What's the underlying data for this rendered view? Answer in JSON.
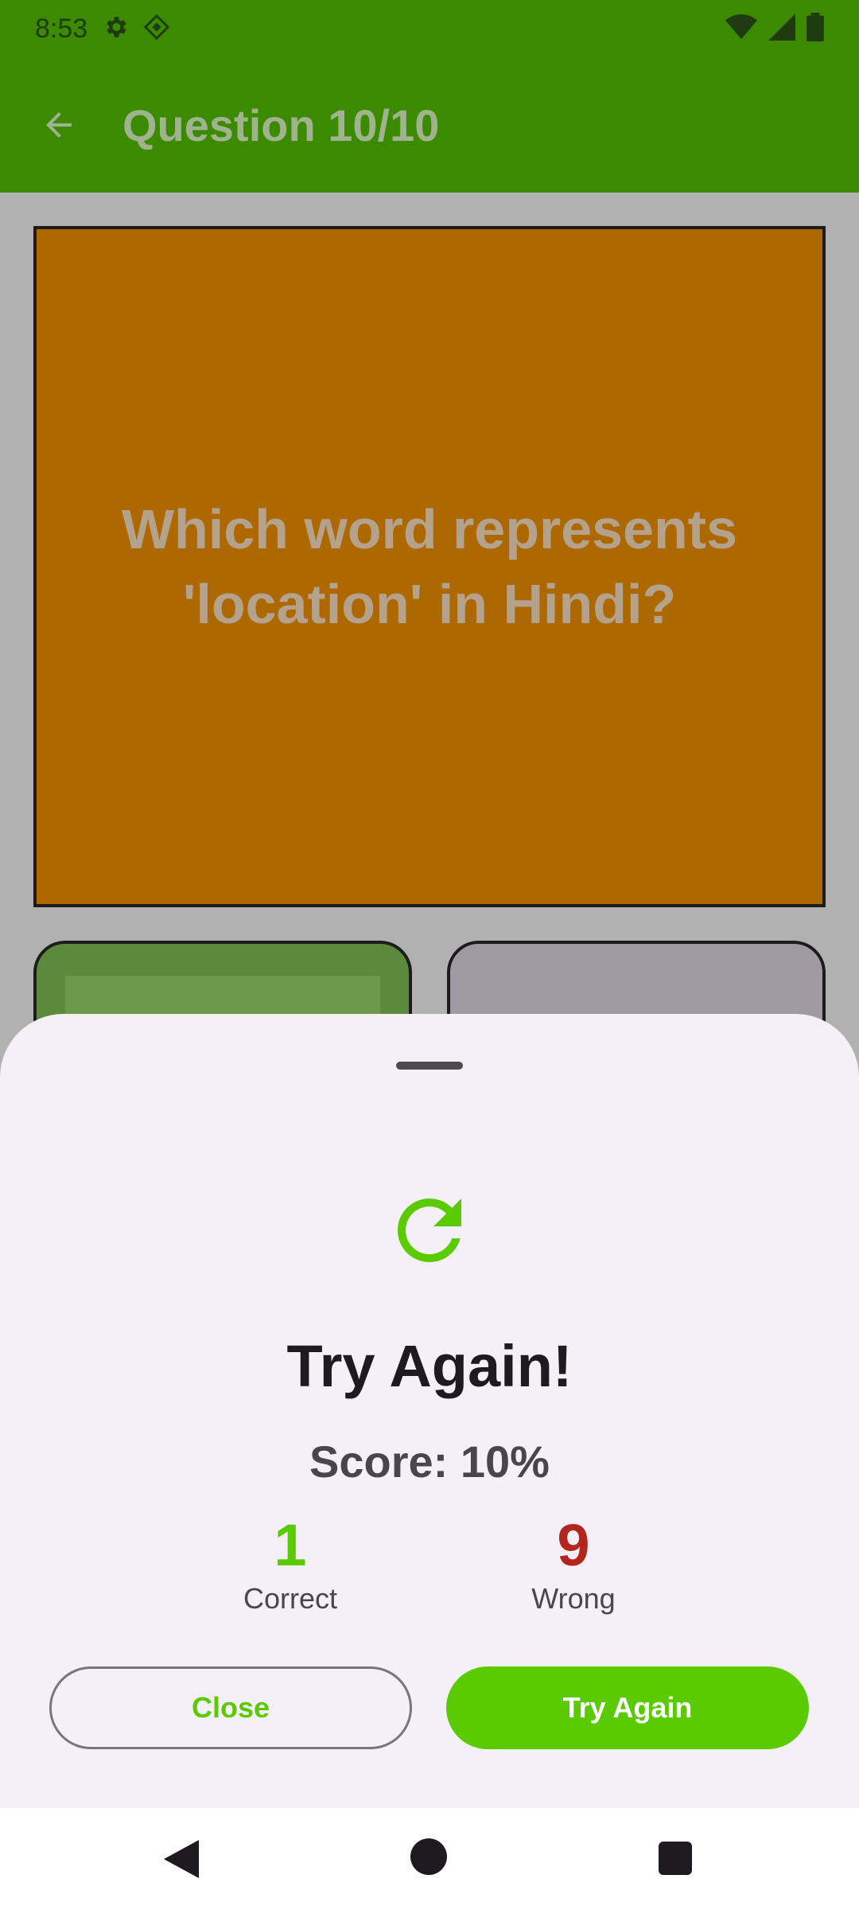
{
  "status_bar": {
    "time": "8:53",
    "icons_left": [
      "settings-icon",
      "diamond-app-icon"
    ],
    "icons_right": [
      "wifi-icon",
      "cellular-signal-icon",
      "battery-icon"
    ]
  },
  "app_bar": {
    "back_icon": "arrow-back-icon",
    "title": "Question 10/10",
    "background": "#3c8a00"
  },
  "question": {
    "text": "Which word represents 'location' in Hindi?",
    "card_color": "#ad6900"
  },
  "result_sheet": {
    "icon": "refresh-icon",
    "title": "Try Again!",
    "score_text": "Score: 10%",
    "correct": {
      "count": "1",
      "label": "Correct"
    },
    "wrong": {
      "count": "9",
      "label": "Wrong"
    },
    "close_label": "Close",
    "try_again_label": "Try Again",
    "accent_color": "#5acb00",
    "wrong_color": "#b3261e"
  },
  "nav_bar": {
    "icons": [
      "nav-back-icon",
      "nav-home-icon",
      "nav-recents-icon"
    ]
  }
}
